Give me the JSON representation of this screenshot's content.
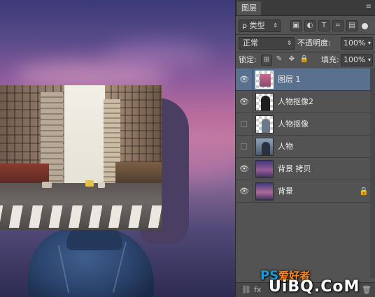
{
  "panel": {
    "tab_label": "图层",
    "filter_label": "ρ 类型",
    "blend_mode": "正常",
    "opacity_label": "不透明度:",
    "opacity_value": "100%",
    "lock_label": "锁定:",
    "fill_label": "填充:",
    "fill_value": "100%"
  },
  "layers": [
    {
      "name": "图层 1",
      "visible": true,
      "selected": true
    },
    {
      "name": "人物抠像2",
      "visible": true,
      "selected": false
    },
    {
      "name": "人物抠像",
      "visible": false,
      "selected": false
    },
    {
      "name": "人物",
      "visible": false,
      "selected": false
    },
    {
      "name": "背景 拷贝",
      "visible": true,
      "selected": false
    },
    {
      "name": "背景",
      "visible": true,
      "selected": false,
      "locked": true
    }
  ],
  "watermark": {
    "line1_ps": "PS",
    "line1_rest": "爱好者",
    "line2": "UiBQ.CoM"
  },
  "colors": {
    "panel_bg": "#535353",
    "selected_layer": "#59708e",
    "canvas_sky_top": "#3c3a78",
    "canvas_sky_pink": "#b76b9c"
  }
}
